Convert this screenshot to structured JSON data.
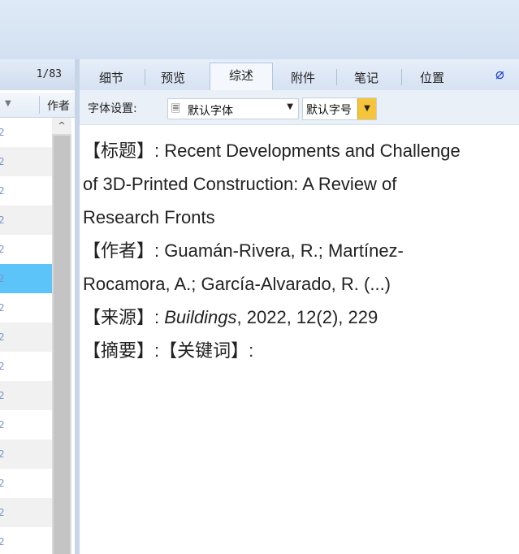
{
  "list": {
    "counter": "1/83",
    "column_label": "作者",
    "row_count": 15,
    "selected_row_index": 5
  },
  "tabs": [
    {
      "label": "细节"
    },
    {
      "label": "预览"
    },
    {
      "label": "综述",
      "active": true
    },
    {
      "label": "附件"
    },
    {
      "label": "笔记"
    },
    {
      "label": "位置"
    }
  ],
  "fontbar": {
    "label": "字体设置:",
    "font_value": "默认字体",
    "size_value": "默认字号"
  },
  "record": {
    "title_label": "【标题】:",
    "title_line1": "Recent Developments and Challenge",
    "title_line2": "of 3D-Printed Construction: A Review of",
    "title_line3": "Research Fronts",
    "author_label": "【作者】:",
    "author_line1": "Guamán-Rivera, R.; Martínez-",
    "author_line2": "Rocamora, A.; García-Alvarado, R. (...)",
    "source_label": "【来源】:",
    "source_journal": "Buildings",
    "source_rest": ", 2022, 12(2), 229",
    "abstract_label": "【摘要】:",
    "keywords_label": "【关键词】:"
  },
  "icons": {
    "attachment": "paperclip-icon",
    "font": "font-icon"
  },
  "colors": {
    "selected_row": "#5cc4f8",
    "size_dropdown": "#f6c43a",
    "clip": "#1a3fd6"
  }
}
